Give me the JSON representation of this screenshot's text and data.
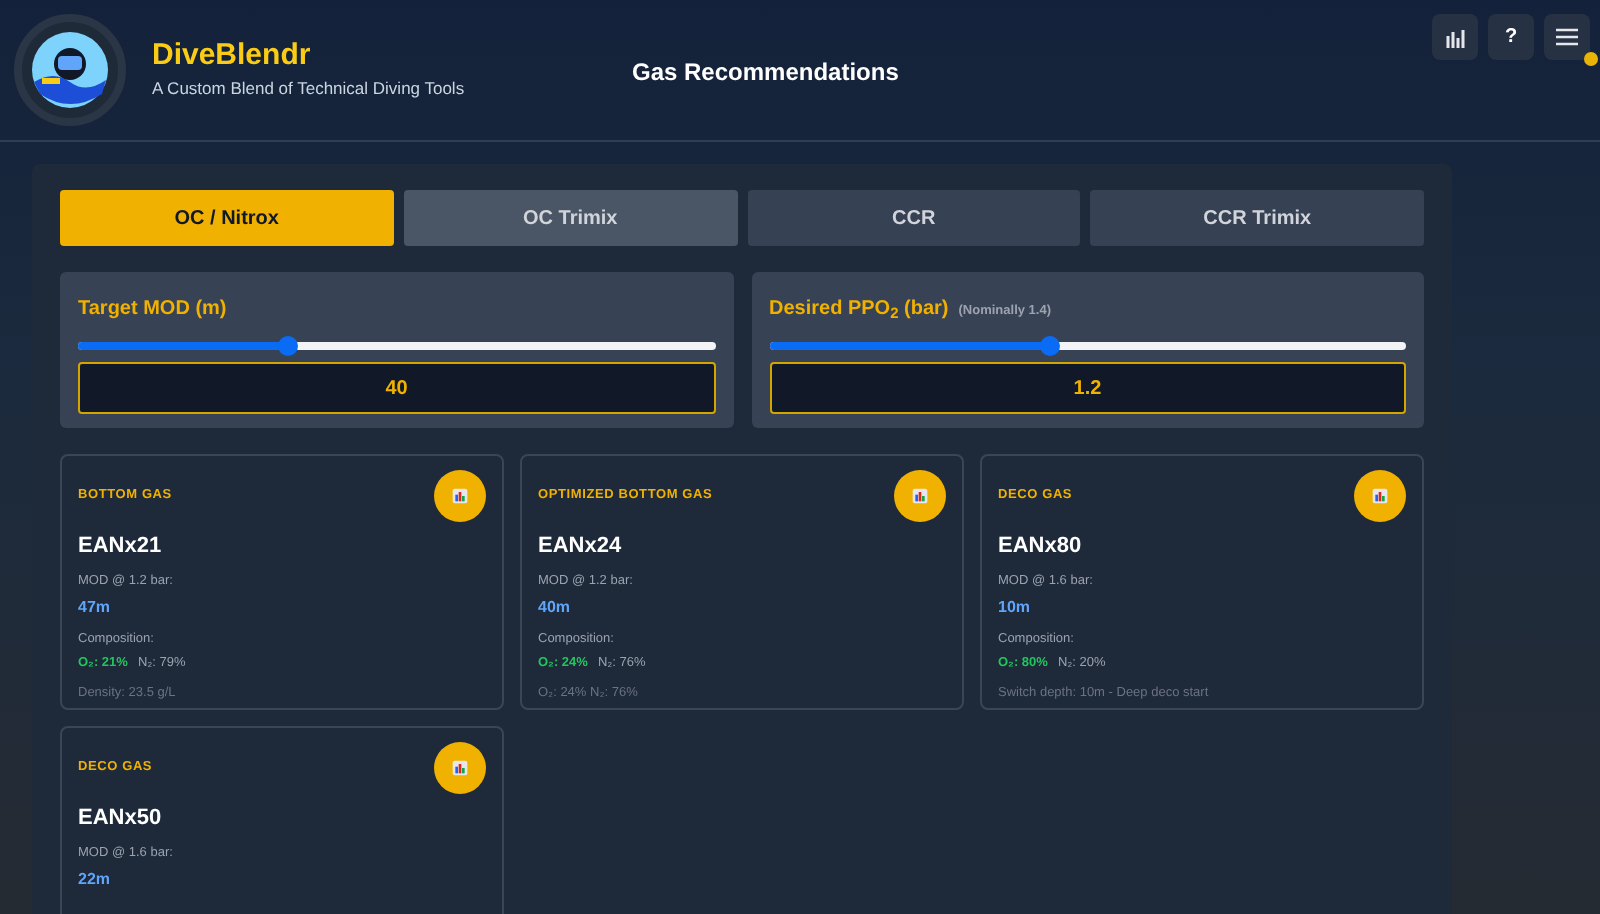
{
  "header": {
    "app_name": "DiveBlendr",
    "tagline": "A Custom Blend of Technical Diving Tools",
    "page_title": "Gas Recommendations",
    "help_label": "?",
    "menu_notification": true
  },
  "tabs": [
    {
      "label": "OC / Nitrox",
      "selected": true
    },
    {
      "label": "OC Trimix",
      "selected": false
    },
    {
      "label": "CCR",
      "selected": false
    },
    {
      "label": "CCR Trimix",
      "selected": false
    }
  ],
  "inputs": [
    {
      "label": "Target MOD (m)",
      "level": 0.33,
      "value": "40"
    },
    {
      "label": "Desired PPO$_{2}$ (bar)",
      "note": "(Nominally 1.4)",
      "level": 0.44,
      "value": "1.2"
    }
  ],
  "gases": [
    {
      "category": "BOTTOM GAS",
      "name": "EANx21",
      "mod_label": "MOD @ 1.2 bar:",
      "mod": "47m",
      "composition_label": "Composition:",
      "o2": "O₂: 21%",
      "n2": "N₂: 79%",
      "note": "Density: 23.5 g/L"
    },
    {
      "category": "OPTIMIZED BOTTOM GAS",
      "name": "EANx24",
      "mod_label": "MOD @ 1.2 bar:",
      "mod": "40m",
      "composition_label": "Composition:",
      "o2": "O₂: 24%",
      "n2": "N₂: 76%",
      "note": "O₂: 24% N₂: 76%"
    },
    {
      "category": "DECO GAS",
      "name": "EANx80",
      "mod_label": "MOD @ 1.6 bar:",
      "mod": "10m",
      "composition_label": "Composition:",
      "o2": "O₂: 80%",
      "n2": "N₂: 20%",
      "note": "Switch depth: 10m - Deep deco start"
    },
    {
      "category": "DECO GAS",
      "name": "EANx50",
      "mod_label": "MOD @ 1.6 bar:",
      "mod": "22m"
    }
  ]
}
